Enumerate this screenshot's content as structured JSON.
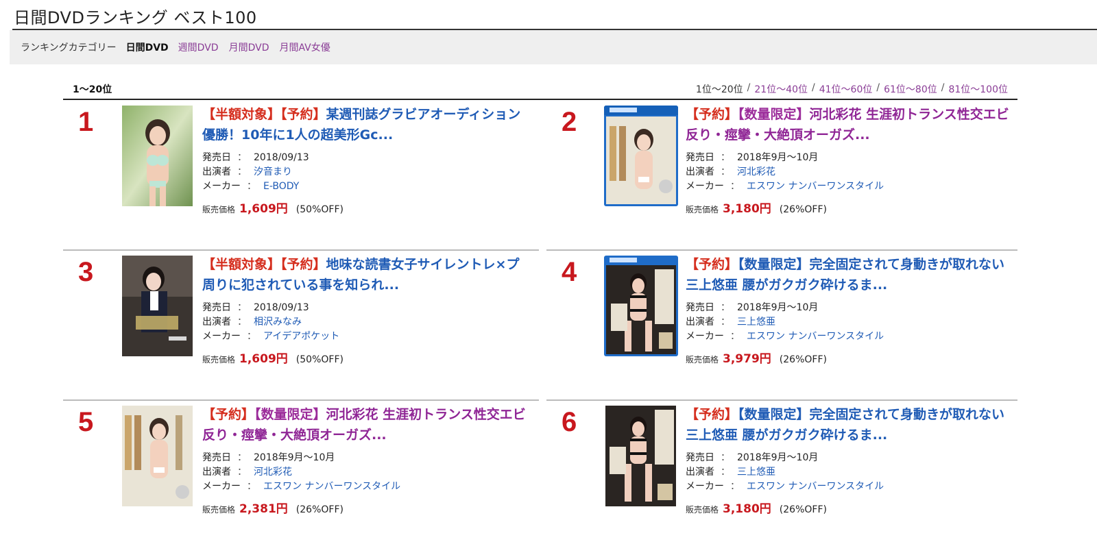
{
  "page_title": "日間DVDランキング ベスト100",
  "category_bar": {
    "label": "ランキングカテゴリー",
    "current": "日間DVD",
    "links": [
      "週間DVD",
      "月間DVD",
      "月間AV女優"
    ]
  },
  "range_bar": {
    "current": "1〜20位",
    "pager_current": "1位〜20位",
    "separator": "/",
    "pager_links": [
      "21位〜40位",
      "41位〜60位",
      "61位〜80位",
      "81位〜100位"
    ]
  },
  "labels": {
    "release": "発売日",
    "performer": "出演者",
    "maker": "メーカー",
    "colon": "：",
    "price": "販売価格"
  },
  "items": [
    {
      "rank": "1",
      "tags": [
        "【半額対象】",
        "【予約】"
      ],
      "title": "某週刊誌グラビアオーディション優勝！10年に1人の超美形Gc...",
      "release": "2018/09/13",
      "performer": "汐音まり",
      "maker": "E-BODY",
      "price": "1,609円",
      "off": "(50%OFF)"
    },
    {
      "rank": "2",
      "tags": [
        "【予約】",
        "【数量限定】"
      ],
      "title": "河北彩花 生涯初トランス性交エビ反り・痙攣・大絶頂オーガズ...",
      "release": "2018年9月〜10月",
      "performer": "河北彩花",
      "maker": "エスワン ナンバーワンスタイル",
      "price": "3,180円",
      "off": "(26%OFF)"
    },
    {
      "rank": "3",
      "tags": [
        "【半額対象】",
        "【予約】"
      ],
      "title": "地味な読書女子サイレントレ×プ 周りに犯されている事を知られ...",
      "release": "2018/09/13",
      "performer": "相沢みなみ",
      "maker": "アイデアポケット",
      "price": "1,609円",
      "off": "(50%OFF)"
    },
    {
      "rank": "4",
      "tags": [
        "【予約】",
        "【数量限定】"
      ],
      "title": "完全固定されて身動きが取れない三上悠亜 腰がガクガク砕けるま...",
      "release": "2018年9月〜10月",
      "performer": "三上悠亜",
      "maker": "エスワン ナンバーワンスタイル",
      "price": "3,979円",
      "off": "(26%OFF)"
    },
    {
      "rank": "5",
      "tags": [
        "【予約】",
        "【数量限定】"
      ],
      "title": "河北彩花 生涯初トランス性交エビ反り・痙攣・大絶頂オーガズ...",
      "release": "2018年9月〜10月",
      "performer": "河北彩花",
      "maker": "エスワン ナンバーワンスタイル",
      "price": "2,381円",
      "off": "(26%OFF)"
    },
    {
      "rank": "6",
      "tags": [
        "【予約】",
        "【数量限定】"
      ],
      "title": "完全固定されて身動きが取れない三上悠亜 腰がガクガク砕けるま...",
      "release": "2018年9月〜10月",
      "performer": "三上悠亜",
      "maker": "エスワン ナンバーワンスタイル",
      "price": "3,180円",
      "off": "(26%OFF)"
    }
  ]
}
